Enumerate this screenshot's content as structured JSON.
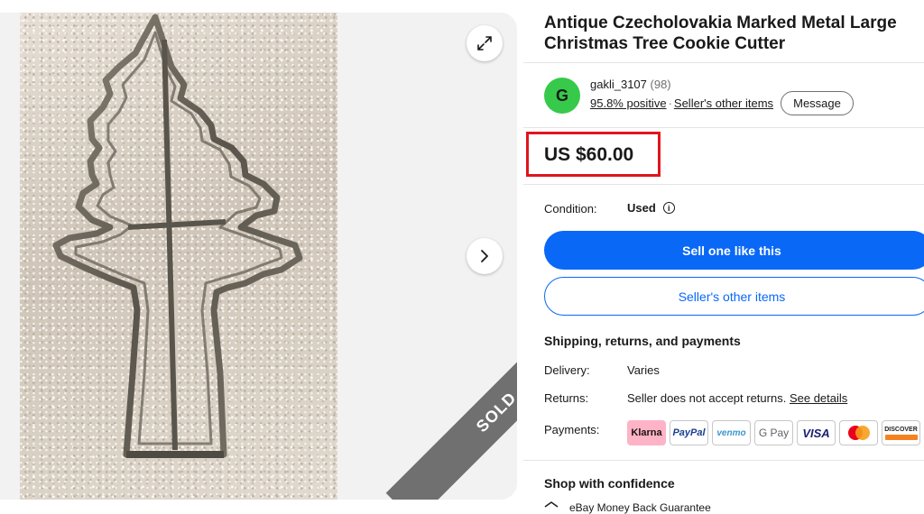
{
  "listing": {
    "title": "Antique Czecholovakia Marked Metal Large Christmas Tree Cookie Cutter",
    "sold_badge": "SOLD",
    "price": "US $60.00"
  },
  "seller": {
    "avatar_letter": "G",
    "name": "gakli_3107",
    "feedback_count": "(98)",
    "positive": "95.8% positive",
    "other_items_link": "Seller's other items",
    "message_label": "Message"
  },
  "condition": {
    "label": "Condition:",
    "value": "Used"
  },
  "actions": {
    "sell_one": "Sell one like this",
    "other_items": "Seller's other items"
  },
  "shipping": {
    "title": "Shipping, returns, and payments",
    "delivery_label": "Delivery:",
    "delivery_value": "Varies",
    "returns_label": "Returns:",
    "returns_value": "Seller does not accept returns.",
    "see_details": "See details",
    "payments_label": "Payments:",
    "methods": [
      "Klarna",
      "PayPal",
      "venmo",
      "G Pay",
      "VISA",
      "Mastercard",
      "DISCOVER"
    ]
  },
  "confidence": {
    "title": "Shop with confidence",
    "guarantee": "eBay Money Back Guarantee"
  },
  "colors": {
    "primary_blue": "#0968f6",
    "highlight_red": "#e0151d",
    "avatar_green": "#36c94a",
    "sold_gray": "#707070"
  },
  "icons": [
    "expand-icon",
    "chevron-right-icon",
    "info-icon",
    "shield-icon"
  ]
}
